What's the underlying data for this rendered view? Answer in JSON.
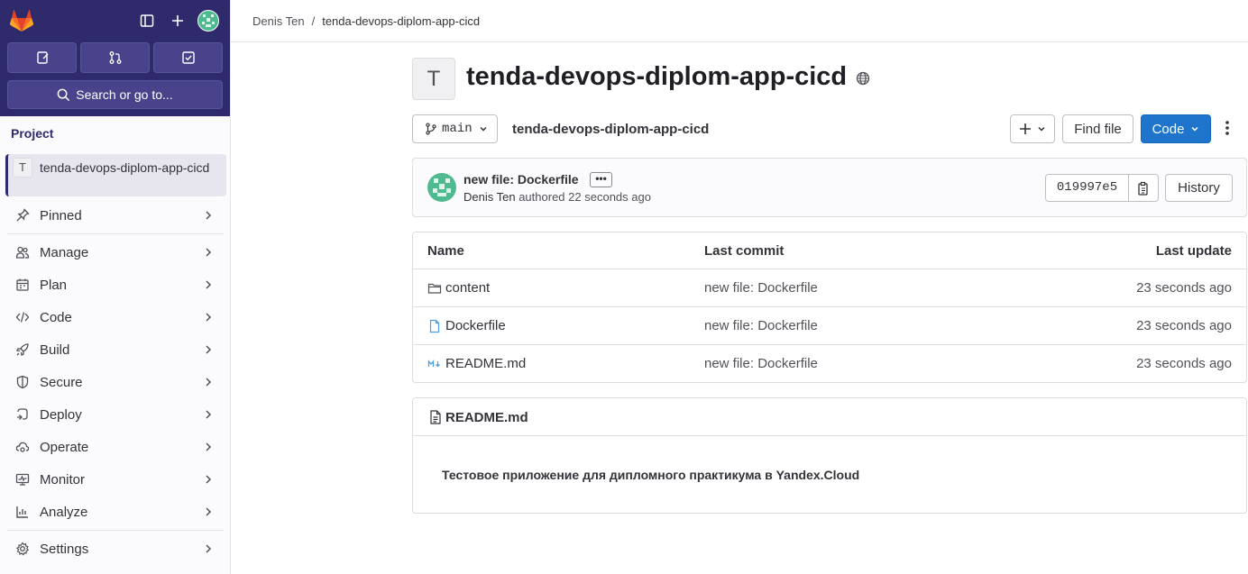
{
  "sidebar": {
    "section_label": "Project",
    "project": {
      "initial": "T",
      "name": "tenda-devops-diplom-app-cicd"
    },
    "search_label": "Search or go to...",
    "items": [
      {
        "label": "Pinned",
        "icon": "pin-icon"
      },
      {
        "label": "Manage",
        "icon": "users-icon"
      },
      {
        "label": "Plan",
        "icon": "calendar-icon"
      },
      {
        "label": "Code",
        "icon": "code-icon"
      },
      {
        "label": "Build",
        "icon": "rocket-icon"
      },
      {
        "label": "Secure",
        "icon": "shield-icon"
      },
      {
        "label": "Deploy",
        "icon": "deploy-icon"
      },
      {
        "label": "Operate",
        "icon": "cloud-gear-icon"
      },
      {
        "label": "Monitor",
        "icon": "monitor-icon"
      },
      {
        "label": "Analyze",
        "icon": "chart-icon"
      },
      {
        "label": "Settings",
        "icon": "gear-icon"
      }
    ]
  },
  "breadcrumb": {
    "owner": "Denis Ten",
    "separator": "/",
    "project": "tenda-devops-diplom-app-cicd"
  },
  "project": {
    "initial": "T",
    "title": "tenda-devops-diplom-app-cicd"
  },
  "toolbar": {
    "branch": "main",
    "path": "tenda-devops-diplom-app-cicd",
    "add_label": "+",
    "find_file": "Find file",
    "code": "Code"
  },
  "commit": {
    "title": "new file: Dockerfile",
    "dots": "•••",
    "author": "Denis Ten",
    "authored": "authored",
    "time": "22 seconds ago",
    "sha": "019997e5",
    "history": "History"
  },
  "files": {
    "headers": {
      "name": "Name",
      "last_commit": "Last commit",
      "last_update": "Last update"
    },
    "rows": [
      {
        "name": "content",
        "type": "folder",
        "commit": "new file: Dockerfile",
        "updated": "23 seconds ago"
      },
      {
        "name": "Dockerfile",
        "type": "file",
        "commit": "new file: Dockerfile",
        "updated": "23 seconds ago"
      },
      {
        "name": "README.md",
        "type": "markdown",
        "commit": "new file: Dockerfile",
        "updated": "23 seconds ago"
      }
    ]
  },
  "readme": {
    "title": "README.md",
    "text": "Тестовое приложение для дипломного практикума в Yandex.Cloud"
  },
  "colors": {
    "sidebar_top": "#2f2a6b",
    "primary": "#1f75cb",
    "avatar": "#4fb990"
  }
}
